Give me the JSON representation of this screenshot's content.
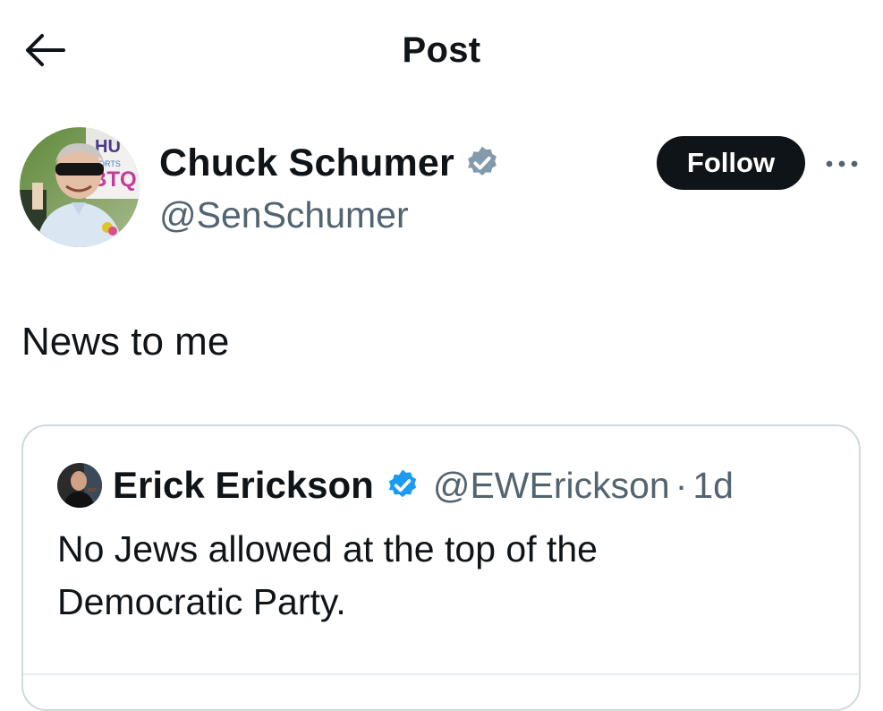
{
  "header": {
    "title": "Post",
    "back_icon": "arrow-left-icon"
  },
  "author": {
    "display_name": "Chuck Schumer",
    "handle": "@SenSchumer",
    "verified_badge": "gray-verified-badge-icon",
    "avatar_sign_text": "HU BTQ"
  },
  "actions": {
    "follow_label": "Follow",
    "more_icon": "more-horizontal-icon"
  },
  "post": {
    "text": "News to me"
  },
  "quoted_post": {
    "display_name": "Erick Erickson",
    "handle": "@EWErickson",
    "separator": "·",
    "time": "1d",
    "verified_badge": "blue-verified-badge-icon",
    "text": "No Jews allowed at the top of the Democratic Party."
  },
  "colors": {
    "text_primary": "#0f1419",
    "text_secondary": "#536471",
    "follow_button_bg": "#0f1419",
    "verified_blue": "#1d9bf0",
    "verified_gray": "#829aab",
    "border": "#cfd9de"
  }
}
